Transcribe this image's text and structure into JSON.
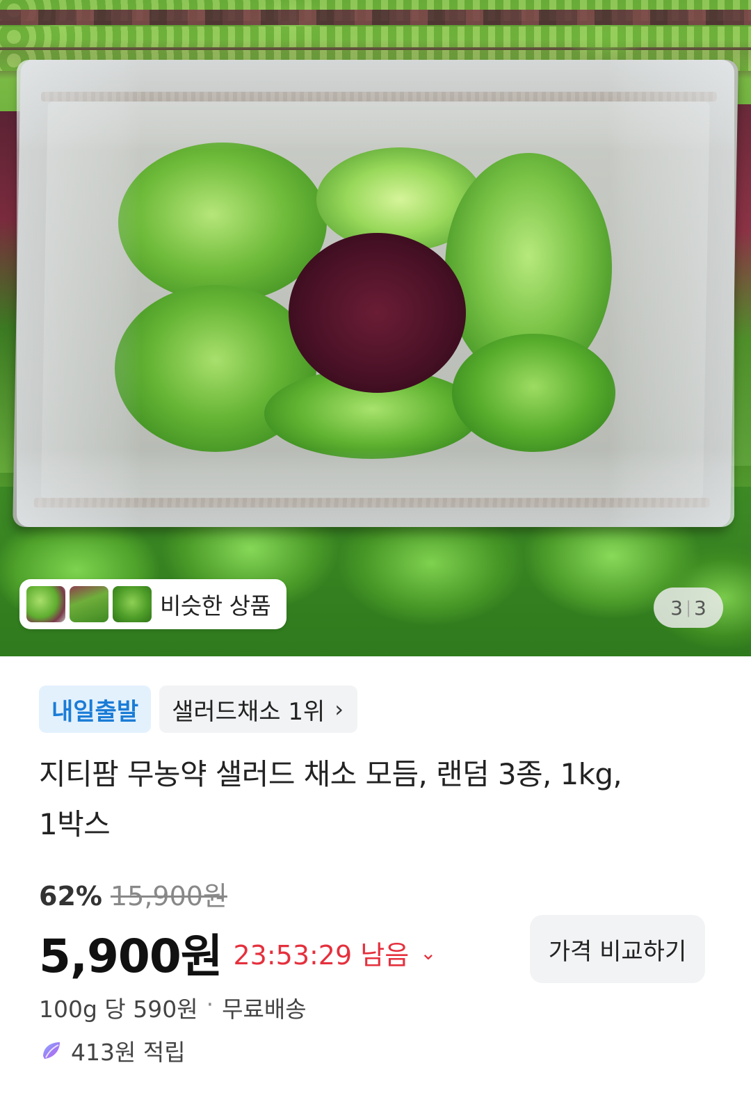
{
  "gallery": {
    "similar_label": "비슷한 상품",
    "pager_current": "3",
    "pager_total": "3"
  },
  "badges": {
    "delivery": "내일출발",
    "ranking": "샐러드채소 1위"
  },
  "product": {
    "title_line1": "지티팜 무농약 샐러드 채소 모듬, 랜덤 3종, 1kg,",
    "title_line2": "1박스"
  },
  "pricing": {
    "discount": "62%",
    "original_price": "15,900원",
    "price": "5,900원",
    "timer": "23:53:29 남음",
    "compare_label": "가격 비교하기",
    "unit_price": "100g 당 590원",
    "shipping": "무료배송",
    "points": "413원 적립"
  },
  "colors": {
    "timer_red": "#e5303d",
    "badge_blue": "#1b7cd6",
    "badge_blue_bg": "#e3f1fd"
  }
}
